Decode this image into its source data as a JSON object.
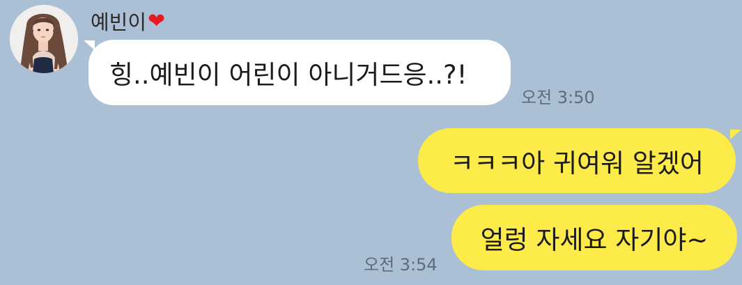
{
  "chat": {
    "sender_name": "예빈이",
    "heart_icon_char": "❤",
    "avatar_icon": "profile-photo-avatar",
    "messages": [
      {
        "direction": "incoming",
        "text": "힝..예빈이 어린이 아니거드응..?!",
        "time": "오전 3:50"
      },
      {
        "direction": "outgoing",
        "text": "ㅋㅋㅋ아 귀여워 알겠어",
        "time": ""
      },
      {
        "direction": "outgoing",
        "text": "얼렁 자세요 자기야~",
        "time": "오전 3:54"
      }
    ]
  },
  "colors": {
    "background": "#acc0d5",
    "incoming_bubble": "#ffffff",
    "outgoing_bubble": "#fdeb4a",
    "heart": "#e31b23",
    "time_text": "#5f6b77"
  }
}
